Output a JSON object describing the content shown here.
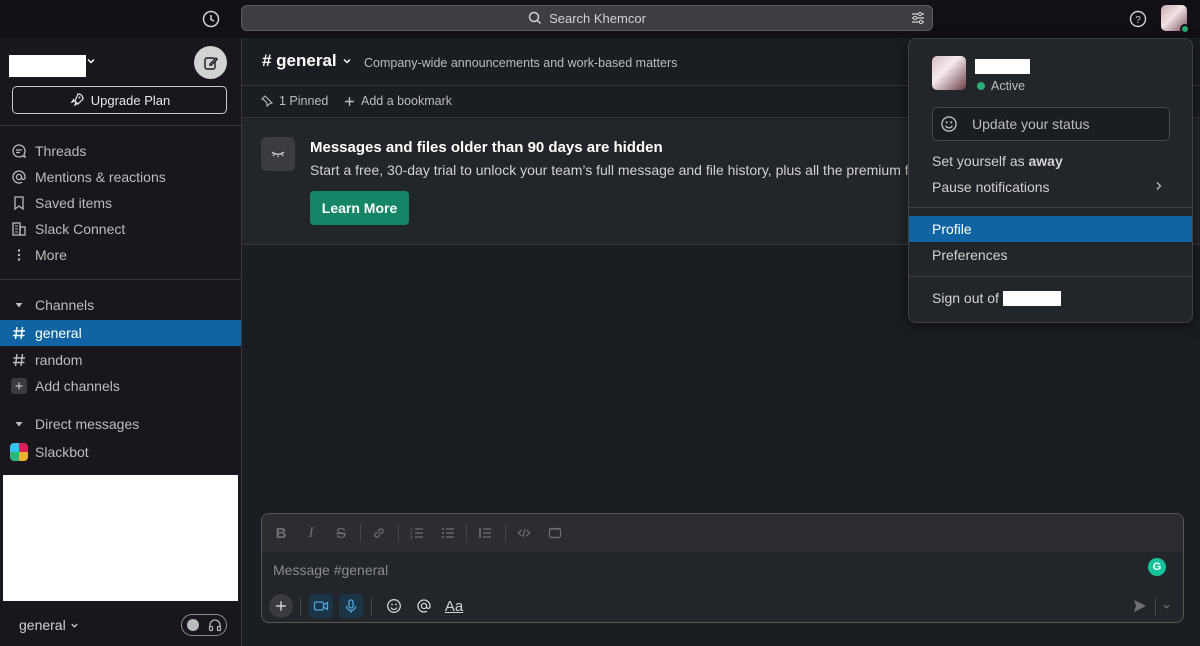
{
  "topbar": {
    "search_text": "Search Khemcor"
  },
  "sidebar": {
    "upgrade_label": "Upgrade Plan",
    "nav": [
      {
        "label": "Threads",
        "icon": "threads-icon"
      },
      {
        "label": "Mentions & reactions",
        "icon": "at-icon"
      },
      {
        "label": "Saved items",
        "icon": "bookmark-icon"
      },
      {
        "label": "Slack Connect",
        "icon": "building-icon"
      },
      {
        "label": "More",
        "icon": "more-vertical-icon"
      }
    ],
    "channels_header": "Channels",
    "channels": [
      {
        "label": "general",
        "active": true
      },
      {
        "label": "random",
        "active": false
      }
    ],
    "add_channels_label": "Add channels",
    "dm_header": "Direct messages",
    "dms": [
      {
        "label": "Slackbot"
      }
    ],
    "footer_workspace": "general"
  },
  "channel": {
    "name": "# general",
    "description": "Company-wide announcements and work-based matters",
    "pinned_label": "1 Pinned",
    "bookmark_label": "Add a bookmark"
  },
  "banner": {
    "title": "Messages and files older than 90 days are hidden",
    "text": "Start a free, 30-day trial to unlock your team’s full message and file history, plus all the premium features",
    "button_label": "Learn More"
  },
  "composer": {
    "placeholder": "Message #general",
    "format_label": "Aa"
  },
  "user_menu": {
    "status_text": "Active",
    "update_status_label": "Update your status",
    "set_away_prefix": "Set yourself as",
    "set_away_word": "away",
    "pause_label": "Pause notifications",
    "profile_label": "Profile",
    "preferences_label": "Preferences",
    "signout_label": "Sign out of"
  },
  "colors": {
    "accent_blue": "#1164a3",
    "learn_green": "#148567",
    "presence_green": "#2bac76",
    "background": "#1a1d21"
  }
}
